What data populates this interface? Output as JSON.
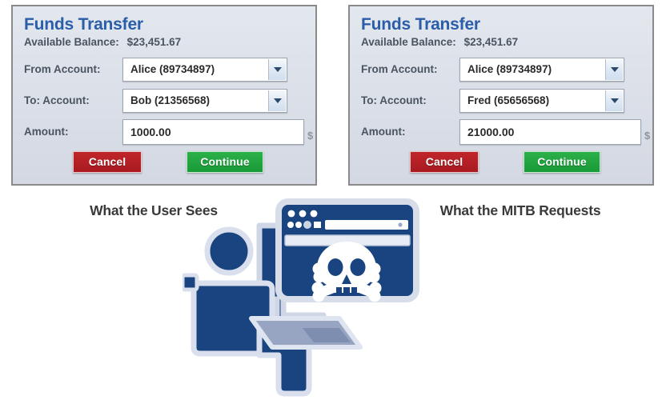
{
  "panels": [
    {
      "id": "user-view",
      "title": "Funds Transfer",
      "balance_label": "Available Balance:",
      "balance_value": "$23,451.67",
      "fields": [
        {
          "label": "From Account:",
          "value": "Alice (89734897)",
          "control": "select",
          "icon": "chevron-down-icon"
        },
        {
          "label": "To: Account:",
          "value": "Bob (21356568)",
          "control": "select",
          "icon": "chevron-down-icon"
        },
        {
          "label": "Amount:",
          "value": "1000.00",
          "control": "text",
          "suffix": "$"
        }
      ],
      "cancel_label": "Cancel",
      "continue_label": "Continue",
      "caption": "What the User Sees"
    },
    {
      "id": "mitb-view",
      "title": "Funds Transfer",
      "balance_label": "Available Balance:",
      "balance_value": "$23,451.67",
      "fields": [
        {
          "label": "From Account:",
          "value": "Alice (89734897)",
          "control": "select",
          "icon": "chevron-down-icon"
        },
        {
          "label": "To: Account:",
          "value": "Fred (65656568)",
          "control": "select",
          "icon": "chevron-down-icon"
        },
        {
          "label": "Amount:",
          "value": "21000.00",
          "control": "text",
          "suffix": "$"
        }
      ],
      "cancel_label": "Cancel",
      "continue_label": "Continue",
      "caption": "What the MITB Requests"
    }
  ],
  "captions": {
    "left": "What the User Sees",
    "right": "What the MITB Requests"
  },
  "illustration": {
    "name": "mitb-attack-illustration",
    "browser_window": "browser-window-icon",
    "threat_icon": "skull-and-crossbones-icon",
    "person": "person-at-computer-icon"
  },
  "colors": {
    "title_blue": "#2a5ea8",
    "panel_bg": "#dde1e9",
    "panel_border": "#8a8a8a",
    "label_gray": "#4a5561",
    "cancel_red": "#b01c22",
    "continue_green": "#1f9d39",
    "illustration_blue": "#1a4480",
    "illustration_light": "#c3ccde"
  }
}
